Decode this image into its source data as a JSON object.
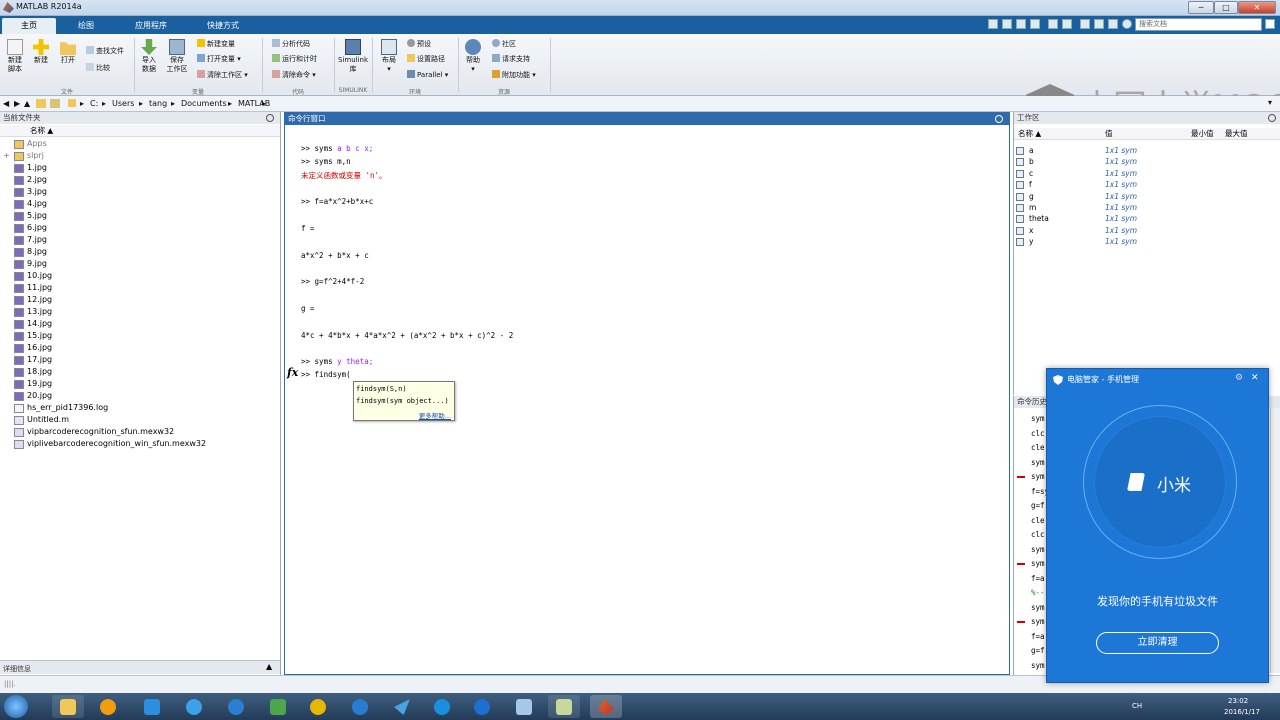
{
  "window": {
    "title": "MATLAB R2014a",
    "min_label": "─",
    "max_label": "□",
    "close_label": "✕"
  },
  "tabs": [
    {
      "label": "主页"
    },
    {
      "label": "绘图"
    },
    {
      "label": "应用程序"
    },
    {
      "label": "快捷方式"
    }
  ],
  "search": {
    "placeholder": "搜索文档"
  },
  "ribbon": {
    "new_script": "新建\n脚本",
    "new": "新建",
    "open": "打开",
    "find_files": "查找文件",
    "compare": "比较",
    "import_data": "导入\n数据",
    "save_workspace": "保存\n工作区",
    "new_variable": "新建变量",
    "open_variable": "打开变量",
    "clear_workspace": "清除工作区",
    "analyze_code": "分析代码",
    "run_and_time": "运行和计时",
    "clear_commands": "清除命令",
    "simulink": "Simulink\n库",
    "layout": "布局",
    "preferences": "预设",
    "set_path": "设置路径",
    "parallel": "Parallel",
    "help": "帮助",
    "community": "社区",
    "request_support": "请求支持",
    "addons": "附加功能",
    "groups": {
      "file": "文件",
      "variable": "变量",
      "code": "代码",
      "simulink": "SIMULINK",
      "environment": "环境",
      "resources": "资源"
    }
  },
  "watermark": "中国大学MOOC",
  "address": {
    "path": [
      "C:",
      "Users",
      "tang",
      "Documents",
      "MATLAB"
    ],
    "sep": "▸"
  },
  "current_folder": {
    "title": "当前文件夹",
    "col_name": "名称 ▲",
    "detail": "详细信息",
    "items": [
      "Apps",
      "slprj",
      "1.jpg",
      "2.jpg",
      "3.jpg",
      "4.jpg",
      "5.jpg",
      "6.jpg",
      "7.jpg",
      "8.jpg",
      "9.jpg",
      "10.jpg",
      "11.jpg",
      "12.jpg",
      "13.jpg",
      "14.jpg",
      "15.jpg",
      "16.jpg",
      "17.jpg",
      "18.jpg",
      "19.jpg",
      "20.jpg",
      "hs_err_pid17396.log",
      "Untitled.m",
      "vipbarcoderecognition_sfun.mexw32",
      "viplivebarcoderecognition_win_sfun.mexw32"
    ]
  },
  "command_window": {
    "title": "命令行窗口",
    "lines": [
      {
        "prompt": ">> ",
        "text": "syms ",
        "args": "a b c x;"
      },
      {
        "prompt": ">> ",
        "text": "syms m,n"
      },
      {
        "error": "未定义函数或变量 'n'。"
      },
      {
        "prompt": ">> ",
        "text": "f=a*x^2+b*x+c"
      },
      {
        "text": "f ="
      },
      {
        "text": "a*x^2 + b*x + c"
      },
      {
        "prompt": ">> ",
        "text": "g=f^2+4*f-2"
      },
      {
        "text": "g ="
      },
      {
        "text": "4*c + 4*b*x + 4*a*x^2 + (a*x^2 + b*x + c)^2 - 2"
      },
      {
        "prompt": ">> ",
        "text": "syms ",
        "args": "y theta;"
      },
      {
        "prompt": ">> ",
        "text": "findsym("
      }
    ],
    "fx": "fx",
    "autocomplete": [
      "findsym(S,n)",
      "findsym(sym object...)"
    ],
    "more_help": "更多帮助..."
  },
  "workspace": {
    "title": "工作区",
    "cols": [
      "名称 ▲",
      "值",
      "最小值",
      "最大值"
    ],
    "vars": [
      {
        "name": "a",
        "value": "1x1 sym"
      },
      {
        "name": "b",
        "value": "1x1 sym"
      },
      {
        "name": "c",
        "value": "1x1 sym"
      },
      {
        "name": "f",
        "value": "1x1 sym"
      },
      {
        "name": "g",
        "value": "1x1 sym"
      },
      {
        "name": "m",
        "value": "1x1 sym"
      },
      {
        "name": "theta",
        "value": "1x1 sym"
      },
      {
        "name": "x",
        "value": "1x1 sym"
      },
      {
        "name": "y",
        "value": "1x1 sym"
      }
    ]
  },
  "history": {
    "title": "命令历史",
    "items": [
      "sym",
      "clc",
      "cle",
      "sym",
      "sym",
      "f=sy",
      "g=f",
      "cle",
      "clc",
      "sym",
      "sym",
      "f=a",
      "%--",
      "sym",
      "sym",
      "f=a",
      "g=f",
      "sym"
    ]
  },
  "popup": {
    "title": "电脑管家 - 手机管理",
    "device": "小米",
    "message": "发现你的手机有垃圾文件",
    "button": "立即清理"
  },
  "taskbar": {
    "lang": "CH",
    "time": "23:02",
    "date": "2016/1/17"
  },
  "colors": {
    "ribbon_tab_bg": "#1a5f9e",
    "popup_bg": "#1c77d6",
    "error": "#d00000",
    "arg_purple": "#a020f0",
    "cmd_border": "#2f6aad"
  }
}
